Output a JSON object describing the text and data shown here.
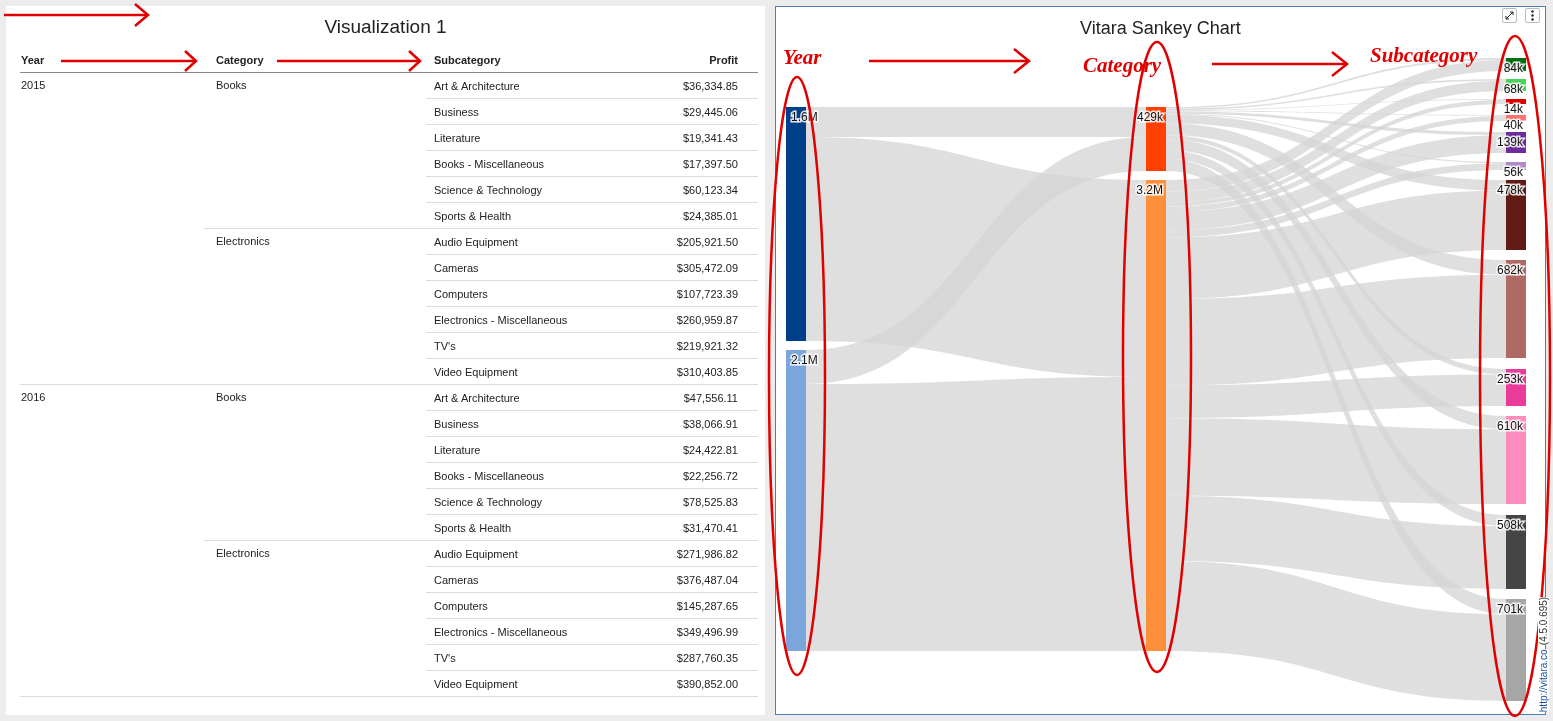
{
  "left_panel": {
    "title": "Visualization 1",
    "columns": [
      "Year",
      "Category",
      "Subcategory",
      "Profit"
    ],
    "groups": [
      {
        "year": "2015",
        "categories": [
          {
            "name": "Books",
            "items": [
              {
                "subcategory": "Art & Architecture",
                "profit": "$36,334.85"
              },
              {
                "subcategory": "Business",
                "profit": "$29,445.06"
              },
              {
                "subcategory": "Literature",
                "profit": "$19,341.43"
              },
              {
                "subcategory": "Books - Miscellaneous",
                "profit": "$17,397.50"
              },
              {
                "subcategory": "Science & Technology",
                "profit": "$60,123.34"
              },
              {
                "subcategory": "Sports & Health",
                "profit": "$24,385.01"
              }
            ]
          },
          {
            "name": "Electronics",
            "items": [
              {
                "subcategory": "Audio Equipment",
                "profit": "$205,921.50"
              },
              {
                "subcategory": "Cameras",
                "profit": "$305,472.09"
              },
              {
                "subcategory": "Computers",
                "profit": "$107,723.39"
              },
              {
                "subcategory": "Electronics - Miscellaneous",
                "profit": "$260,959.87"
              },
              {
                "subcategory": "TV's",
                "profit": "$219,921.32"
              },
              {
                "subcategory": "Video Equipment",
                "profit": "$310,403.85"
              }
            ]
          }
        ]
      },
      {
        "year": "2016",
        "categories": [
          {
            "name": "Books",
            "items": [
              {
                "subcategory": "Art & Architecture",
                "profit": "$47,556.11"
              },
              {
                "subcategory": "Business",
                "profit": "$38,066.91"
              },
              {
                "subcategory": "Literature",
                "profit": "$24,422.81"
              },
              {
                "subcategory": "Books - Miscellaneous",
                "profit": "$22,256.72"
              },
              {
                "subcategory": "Science & Technology",
                "profit": "$78,525.83"
              },
              {
                "subcategory": "Sports & Health",
                "profit": "$31,470.41"
              }
            ]
          },
          {
            "name": "Electronics",
            "items": [
              {
                "subcategory": "Audio Equipment",
                "profit": "$271,986.82"
              },
              {
                "subcategory": "Cameras",
                "profit": "$376,487.04"
              },
              {
                "subcategory": "Computers",
                "profit": "$145,287.65"
              },
              {
                "subcategory": "Electronics - Miscellaneous",
                "profit": "$349,496.99"
              },
              {
                "subcategory": "TV's",
                "profit": "$287,760.35"
              },
              {
                "subcategory": "Video Equipment",
                "profit": "$390,852.00"
              }
            ]
          }
        ]
      }
    ]
  },
  "right_panel": {
    "title": "Vitara Sankey Chart",
    "node_columns": [
      {
        "nodes": [
          {
            "label": "1.6M",
            "color": "#003f8a"
          },
          {
            "label": "2.1M",
            "color": "#7aa6dc"
          }
        ]
      },
      {
        "nodes": [
          {
            "label": "429k",
            "color": "#ff4000"
          },
          {
            "label": "3.2M",
            "color": "#ff8f3a"
          }
        ]
      },
      {
        "nodes": [
          {
            "label": "84k",
            "color": "#006e0c"
          },
          {
            "label": "68k",
            "color": "#4dd15c"
          },
          {
            "label": "14k",
            "color": "#e00000"
          },
          {
            "label": "40k",
            "color": "#ff7070"
          },
          {
            "label": "139k",
            "color": "#6d2b9c"
          },
          {
            "label": "56k",
            "color": "#b08ac8"
          },
          {
            "label": "478k",
            "color": "#621a14"
          },
          {
            "label": "682k",
            "color": "#b06a64"
          },
          {
            "label": "253k",
            "color": "#ea3b9a"
          },
          {
            "label": "610k",
            "color": "#ff8cbf"
          },
          {
            "label": "508k",
            "color": "#454545"
          },
          {
            "label": "701k",
            "color": "#a6a6a6"
          }
        ]
      }
    ],
    "footer_link": "http://vitara.co",
    "footer_version": "(4.5.0.695)"
  },
  "annotations": [
    "Year",
    "Category",
    "Subcategory"
  ]
}
